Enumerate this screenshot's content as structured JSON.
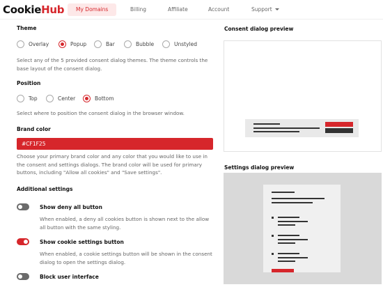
{
  "brand": {
    "logo_part1": "Cookie",
    "logo_part2": "Hub"
  },
  "nav": {
    "items": [
      {
        "label": "My Domains",
        "active": true
      },
      {
        "label": "Billing"
      },
      {
        "label": "Affiliate"
      },
      {
        "label": "Account"
      },
      {
        "label": "Support"
      }
    ]
  },
  "theme": {
    "heading": "Theme",
    "options": [
      "Overlay",
      "Popup",
      "Bar",
      "Bubble",
      "Unstyled"
    ],
    "selected": "Popup",
    "description": "Select any of the 5 provided consent dialog themes. The theme controls the base layout of the consent dialog."
  },
  "position": {
    "heading": "Position",
    "options": [
      "Top",
      "Center",
      "Bottom"
    ],
    "selected": "Bottom",
    "description": "Select where to position the consent dialog in the browser window."
  },
  "brand_color": {
    "heading": "Brand color",
    "value": "#CF1F25",
    "description": "Choose your primary brand color and any color that you would like to use in the consent and settings dialogs. The brand color will be used for primary buttons, including \"Allow all cookies\" and \"Save settings\"."
  },
  "additional": {
    "heading": "Additional settings",
    "items": [
      {
        "label": "Show deny all button",
        "enabled": false,
        "description": "When enabled, a deny all cookies button is shown next to the allow all button with the same styling."
      },
      {
        "label": "Show cookie settings button",
        "enabled": true,
        "description": "When enabled, a cookie settings button will be shown in the consent dialog to open the settings dialog."
      },
      {
        "label": "Block user interface",
        "enabled": false,
        "description": ""
      }
    ]
  },
  "previews": {
    "consent_title": "Consent dialog preview",
    "settings_title": "Settings dialog preview"
  },
  "colors": {
    "accent": "#d6262b",
    "dark": "#333333",
    "muted": "#666666"
  }
}
